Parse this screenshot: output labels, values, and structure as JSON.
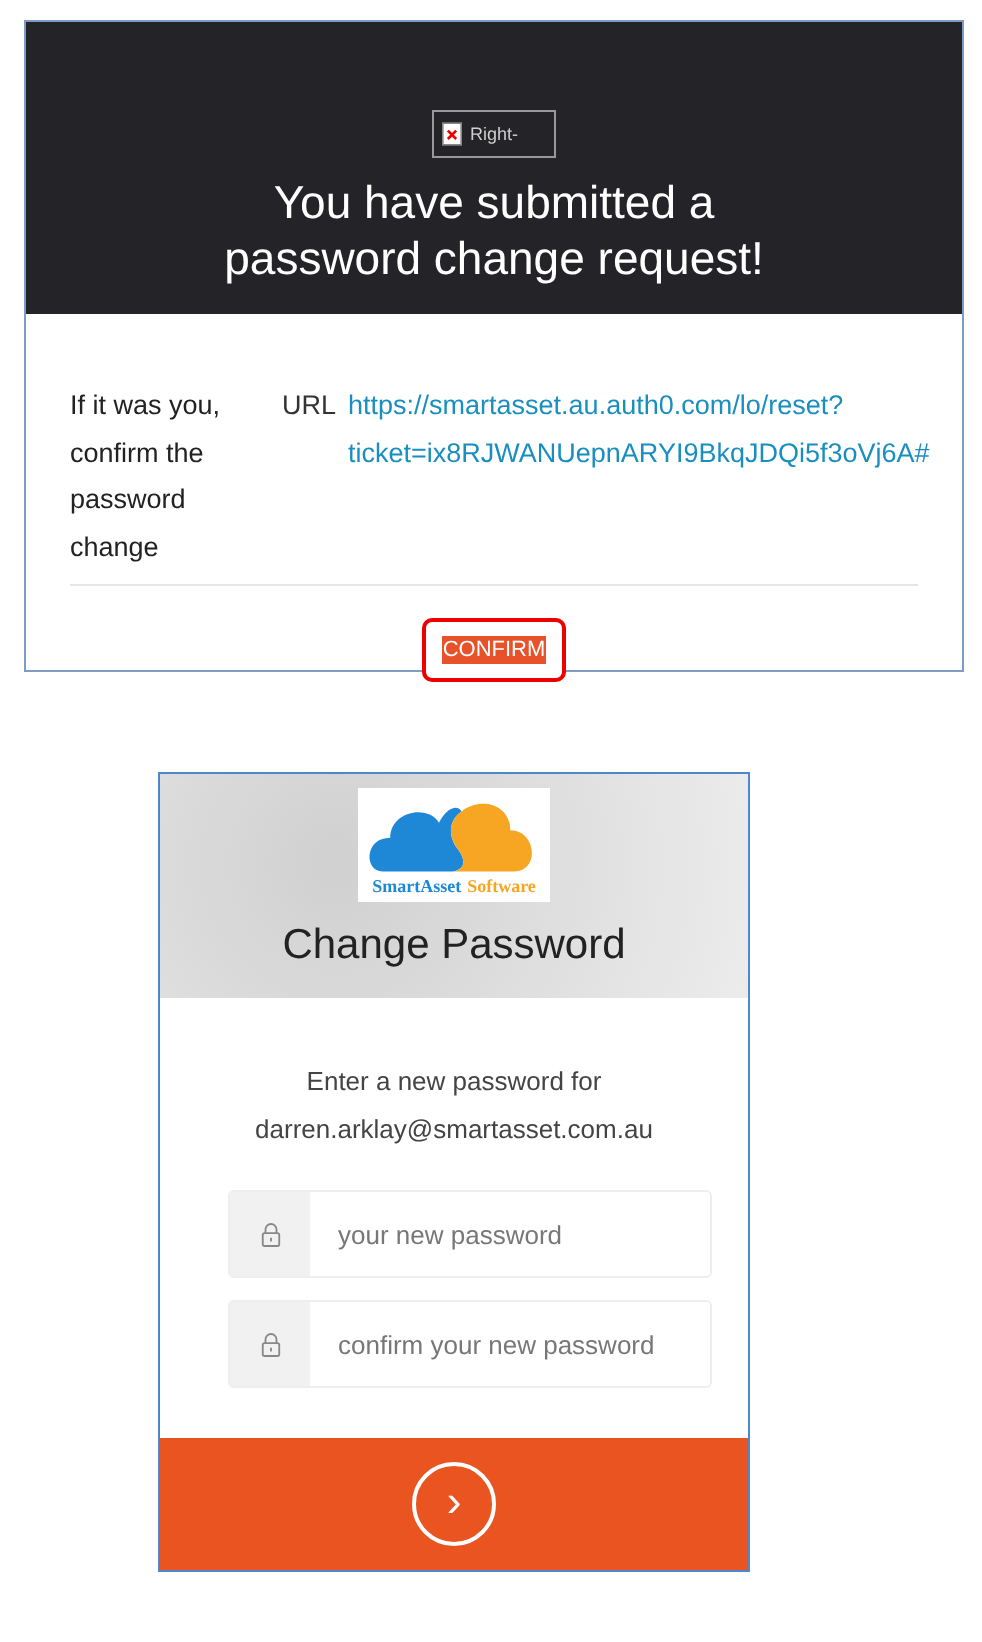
{
  "email": {
    "broken_image_alt": "Right-",
    "title_lines": [
      "You have submitted a",
      "password change request!"
    ],
    "instruction": "If it was you, confirm the password change",
    "url_label": "URL",
    "url_lines": [
      "https://smartasset.au.auth0.com/lo/reset?",
      "ticket=ix8RJWANUepnARYI9BkqJDQi5f3oVj6A#"
    ],
    "confirm_button": "CONFIRM"
  },
  "form": {
    "logo_words": [
      "SmartAsset",
      "Software"
    ],
    "title": "Change Password",
    "prompt_lines": [
      "Enter a new password for",
      "darren.arklay@smartasset.com.au"
    ],
    "fields": [
      {
        "placeholder": "your new password"
      },
      {
        "placeholder": "confirm your new password"
      }
    ],
    "submit_icon": "›"
  }
}
